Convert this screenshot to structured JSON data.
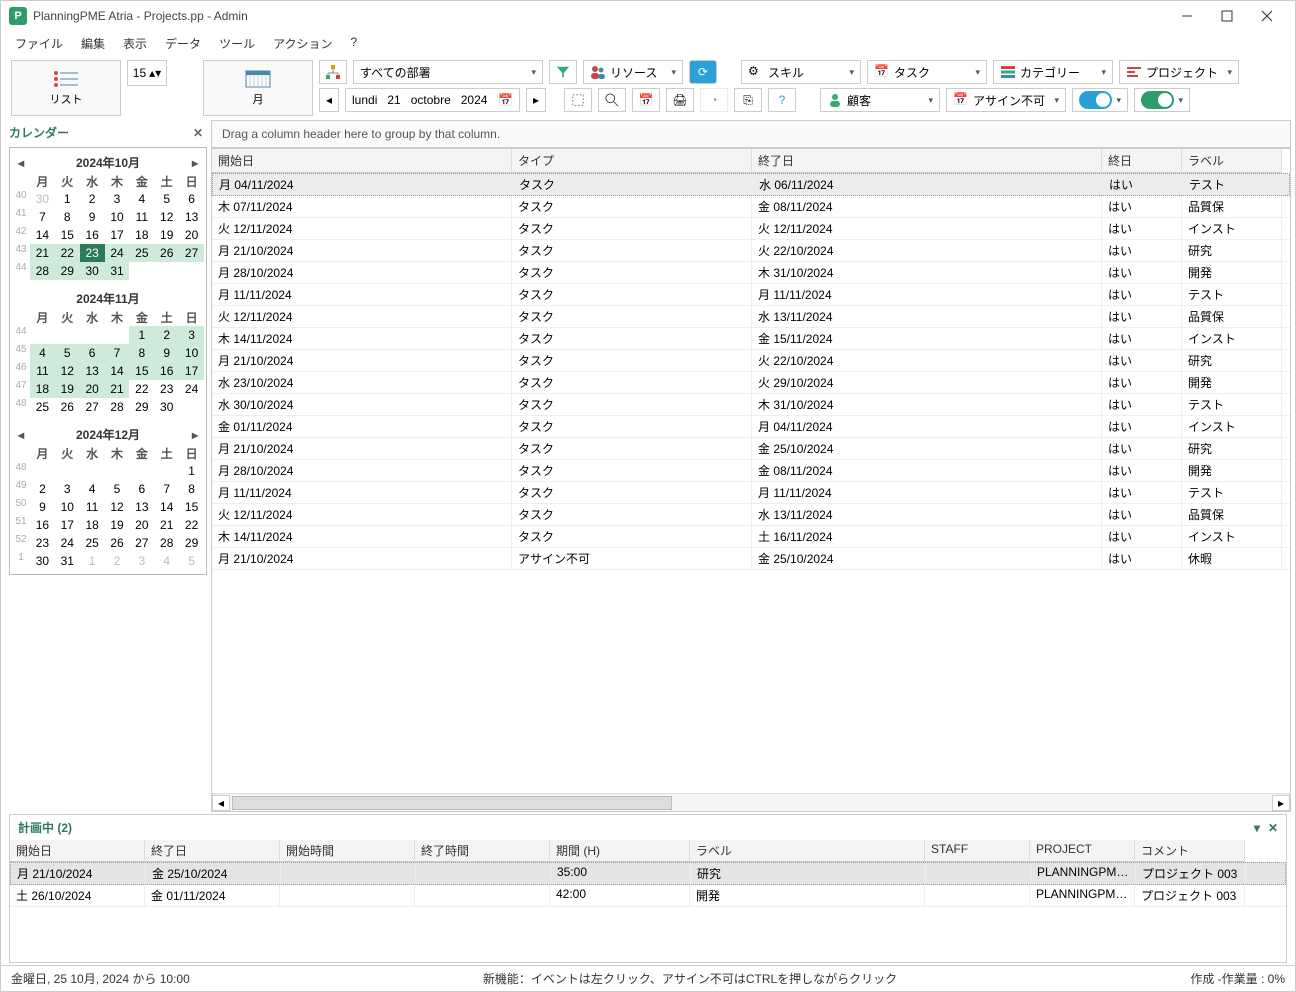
{
  "title": "PlanningPME Atria - Projects.pp - Admin",
  "menu": [
    "ファイル",
    "編集",
    "表示",
    "データ",
    "ツール",
    "アクション",
    "?"
  ],
  "bigbuttons": {
    "list": "リスト",
    "month": "月",
    "spinner": "15"
  },
  "controls": {
    "dept": "すべての部署",
    "resource": "リソース",
    "skill": "スキル",
    "task": "タスク",
    "category": "カテゴリー",
    "project": "プロジェクト",
    "customer": "顧客",
    "unassign": "アサイン不可",
    "date": {
      "dow": "lundi",
      "d": "21",
      "m": "octobre",
      "y": "2024"
    }
  },
  "leftpanel": {
    "title": "カレンダー"
  },
  "months": [
    {
      "label": "2024年10月",
      "wk": [
        40,
        41,
        42,
        43,
        44
      ],
      "leading": [
        30
      ],
      "days": 31,
      "today": 23,
      "hl_start": 21,
      "hl_end": 31,
      "nav": true
    },
    {
      "label": "2024年11月",
      "wk": [
        44,
        45,
        46,
        47,
        48
      ],
      "leading": [
        0,
        0,
        0,
        0
      ],
      "days": 30,
      "hl_start": 1,
      "hl_end": 21,
      "nav": false
    },
    {
      "label": "2024年12月",
      "wk": [
        48,
        49,
        50,
        51,
        52,
        1
      ],
      "leading": [
        0,
        0,
        0,
        0,
        0,
        0
      ],
      "days": 31,
      "trailing": [
        1,
        2,
        3,
        4,
        5
      ],
      "nav": true
    }
  ],
  "dayheads": [
    "月",
    "火",
    "水",
    "木",
    "金",
    "土",
    "日"
  ],
  "grouphint": "Drag a column header here to group by that column.",
  "gridcols": [
    "開始日",
    "タイプ",
    "終了日",
    "終日",
    "ラベル"
  ],
  "rows": [
    {
      "s": "月 04/11/2024",
      "t": "タスク",
      "e": "水 06/11/2024",
      "a": "はい",
      "l": "テスト",
      "sel": true
    },
    {
      "s": "木 07/11/2024",
      "t": "タスク",
      "e": "金 08/11/2024",
      "a": "はい",
      "l": "品質保"
    },
    {
      "s": "火 12/11/2024",
      "t": "タスク",
      "e": "火 12/11/2024",
      "a": "はい",
      "l": "インスト"
    },
    {
      "s": "月 21/10/2024",
      "t": "タスク",
      "e": "火 22/10/2024",
      "a": "はい",
      "l": "研究"
    },
    {
      "s": "月 28/10/2024",
      "t": "タスク",
      "e": "木 31/10/2024",
      "a": "はい",
      "l": "開発"
    },
    {
      "s": "月 11/11/2024",
      "t": "タスク",
      "e": "月 11/11/2024",
      "a": "はい",
      "l": "テスト"
    },
    {
      "s": "火 12/11/2024",
      "t": "タスク",
      "e": "水 13/11/2024",
      "a": "はい",
      "l": "品質保"
    },
    {
      "s": "木 14/11/2024",
      "t": "タスク",
      "e": "金 15/11/2024",
      "a": "はい",
      "l": "インスト"
    },
    {
      "s": "月 21/10/2024",
      "t": "タスク",
      "e": "火 22/10/2024",
      "a": "はい",
      "l": "研究"
    },
    {
      "s": "水 23/10/2024",
      "t": "タスク",
      "e": "火 29/10/2024",
      "a": "はい",
      "l": "開発"
    },
    {
      "s": "水 30/10/2024",
      "t": "タスク",
      "e": "木 31/10/2024",
      "a": "はい",
      "l": "テスト"
    },
    {
      "s": "金 01/11/2024",
      "t": "タスク",
      "e": "月 04/11/2024",
      "a": "はい",
      "l": "インスト"
    },
    {
      "s": "月 21/10/2024",
      "t": "タスク",
      "e": "金 25/10/2024",
      "a": "はい",
      "l": "研究"
    },
    {
      "s": "月 28/10/2024",
      "t": "タスク",
      "e": "金 08/11/2024",
      "a": "はい",
      "l": "開発"
    },
    {
      "s": "月 11/11/2024",
      "t": "タスク",
      "e": "月 11/11/2024",
      "a": "はい",
      "l": "テスト"
    },
    {
      "s": "火 12/11/2024",
      "t": "タスク",
      "e": "水 13/11/2024",
      "a": "はい",
      "l": "品質保"
    },
    {
      "s": "木 14/11/2024",
      "t": "タスク",
      "e": "土 16/11/2024",
      "a": "はい",
      "l": "インスト"
    },
    {
      "s": "月 21/10/2024",
      "t": "アサイン不可",
      "e": "金 25/10/2024",
      "a": "はい",
      "l": "休暇"
    }
  ],
  "bottom": {
    "title": "計画中 (2)",
    "cols": [
      "開始日",
      "終了日",
      "開始時間",
      "終了時間",
      "期間 (H)",
      "ラベル",
      "STAFF",
      "PROJECT",
      "コメント"
    ],
    "rows": [
      {
        "c": [
          "月 21/10/2024",
          "金 25/10/2024",
          "",
          "",
          "35:00",
          "研究",
          "",
          "PLANNINGPME C...",
          "プロジェクト 003"
        ],
        "sel": true
      },
      {
        "c": [
          "土 26/10/2024",
          "金 01/11/2024",
          "",
          "",
          "42:00",
          "開発",
          "",
          "PLANNINGPME N...",
          "プロジェクト 003"
        ]
      }
    ]
  },
  "status": {
    "left": "金曜日, 25 10月, 2024 から 10:00",
    "center": "新機能：イベントは左クリック、アサイン不可はCTRLを押しながらクリック",
    "right": "作成 -作業量 : 0%"
  }
}
